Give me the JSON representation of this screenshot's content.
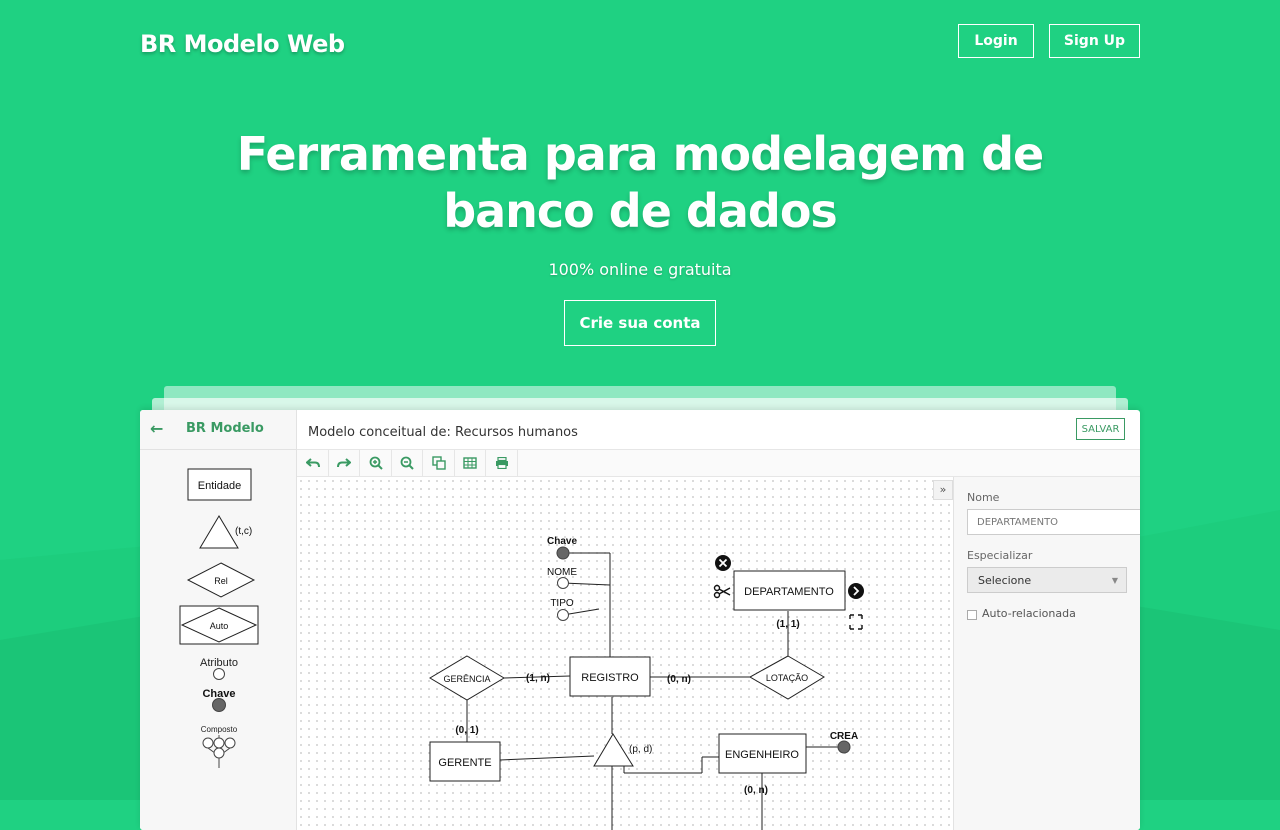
{
  "header": {
    "brand": "BR Modelo Web",
    "login": "Login",
    "signup": "Sign Up"
  },
  "hero": {
    "title_line1": "Ferramenta para modelagem de",
    "title_line2": "banco de dados",
    "subtitle": "100% online e gratuita",
    "cta": "Crie sua conta"
  },
  "app": {
    "sidebar": {
      "title": "BR Modelo",
      "palette": {
        "entity": "Entidade",
        "specialization": "(t,c)",
        "relationship": "Rel",
        "auto": "Auto",
        "attribute": "Atributo",
        "key": "Chave",
        "composite": "Composto"
      }
    },
    "title": "Modelo conceitual de: Recursos humanos",
    "save": "SALVAR",
    "toolbar_icons": [
      "undo-icon",
      "redo-icon",
      "zoom-in-icon",
      "zoom-out-icon",
      "copy-icon",
      "table-icon",
      "print-icon"
    ],
    "diagram": {
      "entities": [
        "REGISTRO",
        "DEPARTAMENTO",
        "GERENTE",
        "ENGENHEIRO"
      ],
      "relationships": [
        "GERÊNCIA",
        "LOTAÇÃO"
      ],
      "attributes": {
        "key": "Chave",
        "nome": "NOME",
        "tipo": "TIPO",
        "crea": "CREA"
      },
      "cardinalities": {
        "registro_gerencia": "(1, n)",
        "registro_lotacao": "(0, n)",
        "departamento": "(1, 1)",
        "gerente": "(0, 1)",
        "engenheiro": "(0, n)"
      },
      "specialization": "(p, d)"
    },
    "properties": {
      "name_label": "Nome",
      "name_value": "DEPARTAMENTO",
      "specialize_label": "Especializar",
      "specialize_value": "Selecione",
      "self_related_label": "Auto-relacionada"
    }
  }
}
